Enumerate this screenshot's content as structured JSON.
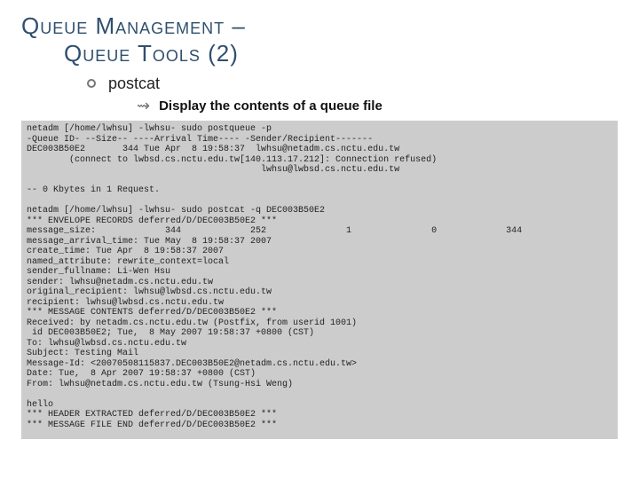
{
  "title": {
    "line1": "Queue Management –",
    "line2": "Queue Tools (2)"
  },
  "bullets": {
    "b1": "postcat",
    "b2": "Display the contents of a queue file"
  },
  "code": "netadm [/home/lwhsu] -lwhsu- sudo postqueue -p\n-Queue ID- --Size-- ----Arrival Time---- -Sender/Recipient-------\nDEC003B50E2       344 Tue Apr  8 19:58:37  lwhsu@netadm.cs.nctu.edu.tw\n        (connect to lwbsd.cs.nctu.edu.tw[140.113.17.212]: Connection refused)\n                                            lwhsu@lwbsd.cs.nctu.edu.tw\n\n-- 0 Kbytes in 1 Request.\n\nnetadm [/home/lwhsu] -lwhsu- sudo postcat -q DEC003B50E2\n*** ENVELOPE RECORDS deferred/D/DEC003B50E2 ***\nmessage_size:             344             252               1               0             344\nmessage_arrival_time: Tue May  8 19:58:37 2007\ncreate_time: Tue Apr  8 19:58:37 2007\nnamed_attribute: rewrite_context=local\nsender_fullname: Li-Wen Hsu\nsender: lwhsu@netadm.cs.nctu.edu.tw\noriginal_recipient: lwhsu@lwbsd.cs.nctu.edu.tw\nrecipient: lwhsu@lwbsd.cs.nctu.edu.tw\n*** MESSAGE CONTENTS deferred/D/DEC003B50E2 ***\nReceived: by netadm.cs.nctu.edu.tw (Postfix, from userid 1001)\n id DEC003B50E2; Tue,  8 May 2007 19:58:37 +0800 (CST)\nTo: lwhsu@lwbsd.cs.nctu.edu.tw\nSubject: Testing Mail\nMessage-Id: <20070508115837.DEC003B50E2@netadm.cs.nctu.edu.tw>\nDate: Tue,  8 Apr 2007 19:58:37 +0800 (CST)\nFrom: lwhsu@netadm.cs.nctu.edu.tw (Tsung-Hsi Weng)\n\nhello\n*** HEADER EXTRACTED deferred/D/DEC003B50E2 ***\n*** MESSAGE FILE END deferred/D/DEC003B50E2 ***"
}
